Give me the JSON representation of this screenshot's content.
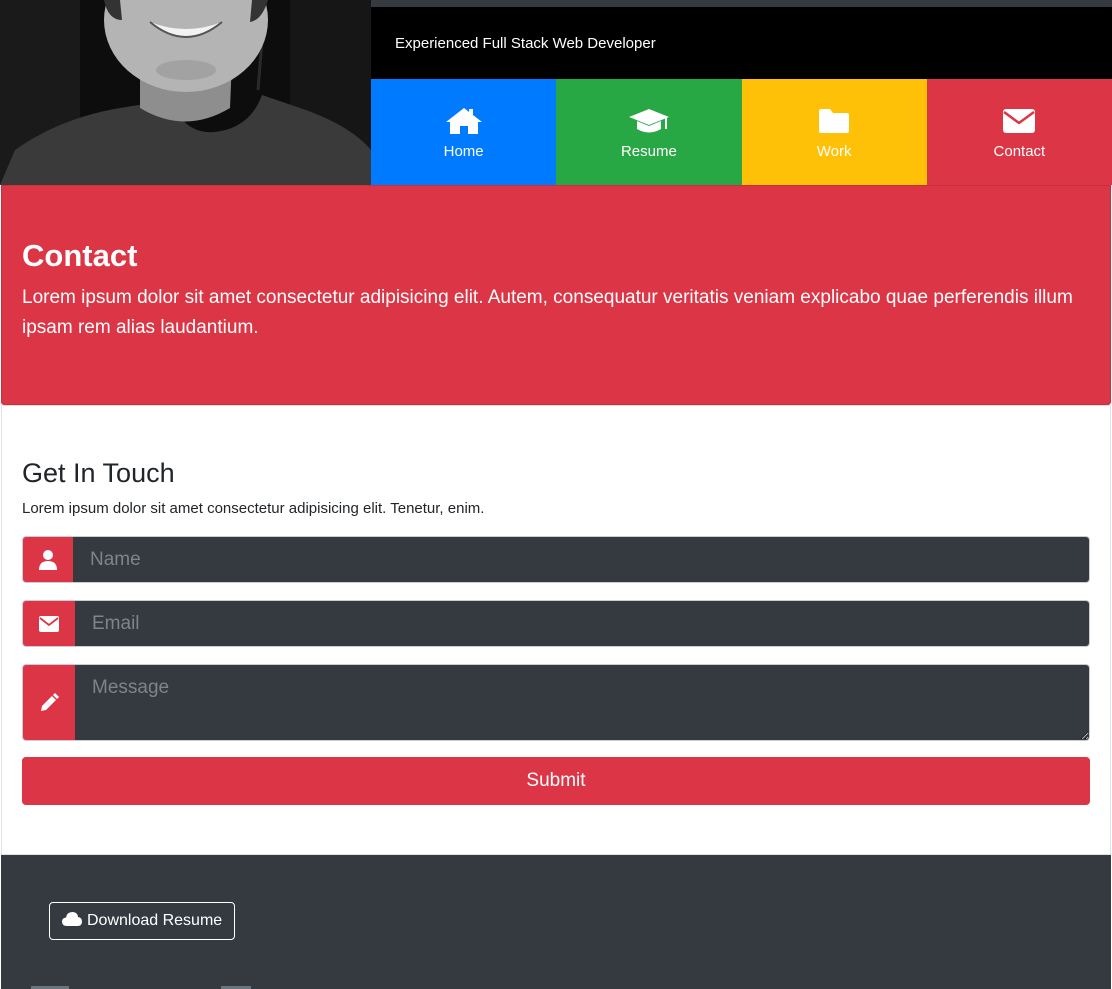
{
  "header": {
    "tagline": "Experienced Full Stack Web Developer",
    "photo_alt": "profile photo"
  },
  "nav": {
    "items": [
      {
        "label": "Home",
        "icon": "home-icon",
        "color": "#007bff"
      },
      {
        "label": "Resume",
        "icon": "graduation-cap-icon",
        "color": "#28a745"
      },
      {
        "label": "Work",
        "icon": "folder-icon",
        "color": "#ffc107"
      },
      {
        "label": "Contact",
        "icon": "envelope-icon",
        "color": "#dc3545"
      }
    ]
  },
  "banner": {
    "title": "Contact",
    "text": "Lorem ipsum dolor sit amet consectetur adipisicing elit. Autem, consequatur veritatis veniam explicabo quae perferendis illum ipsam rem alias laudantium.",
    "color": "#dc3545"
  },
  "form": {
    "title": "Get In Touch",
    "lead": "Lorem ipsum dolor sit amet consectetur adipisicing elit. Tenetur, enim.",
    "name_placeholder": "Name",
    "email_placeholder": "Email",
    "message_placeholder": "Message",
    "submit_label": "Submit"
  },
  "footer": {
    "download_label": "Download Resume",
    "background": "#343a40"
  }
}
